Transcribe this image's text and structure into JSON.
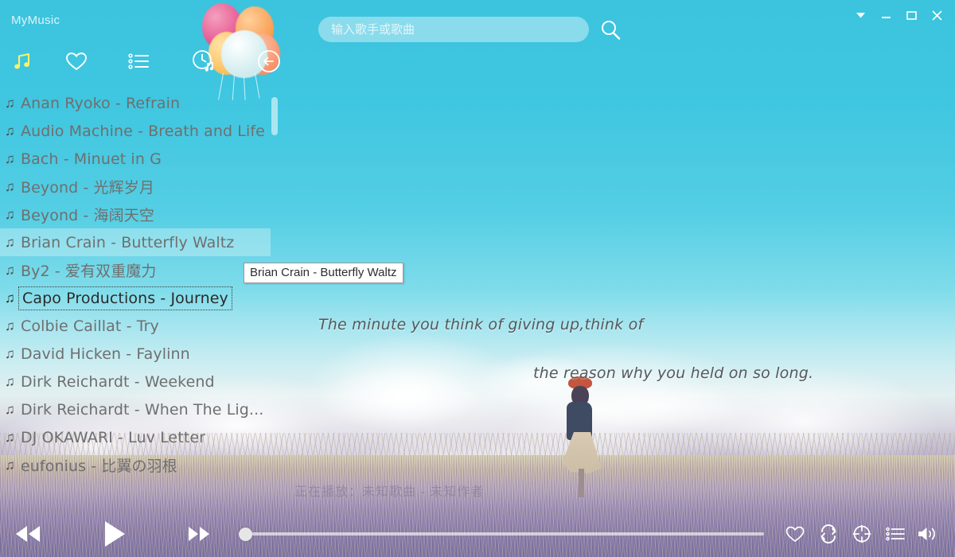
{
  "window": {
    "app_title": "MyMusic",
    "controls": [
      {
        "name": "dropdown",
        "icon": "chevron-down-icon"
      },
      {
        "name": "minimize",
        "icon": "minimize-icon"
      },
      {
        "name": "maximize",
        "icon": "maximize-icon"
      },
      {
        "name": "close",
        "icon": "close-icon"
      }
    ]
  },
  "nav": {
    "items": [
      {
        "name": "music",
        "icon": "music-note-icon",
        "active": true
      },
      {
        "name": "favorites",
        "icon": "heart-icon",
        "active": false
      },
      {
        "name": "playlist",
        "icon": "list-icon",
        "active": false
      },
      {
        "name": "history",
        "icon": "clock-note-icon",
        "active": false
      },
      {
        "name": "back",
        "icon": "back-arrow-icon",
        "active": false
      }
    ]
  },
  "search": {
    "placeholder": "输入歌手或歌曲",
    "value": "",
    "button_icon": "search-icon"
  },
  "songlist": {
    "note_glyph": "♫",
    "hovered_index": 5,
    "selected_index": 7,
    "items": [
      {
        "text": "Anan Ryoko - Refrain"
      },
      {
        "text": "Audio Machine - Breath and Life"
      },
      {
        "text": "Bach - Minuet in G"
      },
      {
        "text": "Beyond - 光辉岁月"
      },
      {
        "text": "Beyond - 海阔天空"
      },
      {
        "text": "Brian Crain - Butterfly Waltz"
      },
      {
        "text": "By2 - 爱有双重魔力"
      },
      {
        "text": "Capo Productions - Journey"
      },
      {
        "text": "Colbie Caillat - Try"
      },
      {
        "text": "David Hicken - Faylinn"
      },
      {
        "text": "Dirk Reichardt - Weekend"
      },
      {
        "text": "Dirk Reichardt - When The Lig..."
      },
      {
        "text": "DJ OKAWARI - Luv Letter"
      },
      {
        "text": "eufonius - 比翼の羽根"
      }
    ]
  },
  "tooltip": {
    "text": "Brian Crain - Butterfly Waltz"
  },
  "wallpaper": {
    "quote_line_1": "The minute you think of giving up,think of",
    "quote_line_2": "the reason why you held on so long."
  },
  "now_playing": {
    "text": "正在播放：未知歌曲 - 未知作者"
  },
  "player": {
    "buttons": [
      {
        "name": "previous",
        "icon": "previous-icon"
      },
      {
        "name": "play",
        "icon": "play-icon"
      },
      {
        "name": "next",
        "icon": "next-icon"
      }
    ],
    "progress_percent": 0,
    "right_buttons": [
      {
        "name": "favorite",
        "icon": "heart-icon"
      },
      {
        "name": "repeat",
        "icon": "repeat-icon"
      },
      {
        "name": "locate",
        "icon": "locate-icon"
      },
      {
        "name": "playlist",
        "icon": "list-icon"
      },
      {
        "name": "volume",
        "icon": "volume-icon"
      }
    ]
  },
  "colors": {
    "sky": "#3fc5e0",
    "accent_active": "#f9f36b",
    "list_text": "#6f6f6f",
    "selected_text": "#2b2b2b",
    "tooltip_bg": "#ffffff"
  }
}
